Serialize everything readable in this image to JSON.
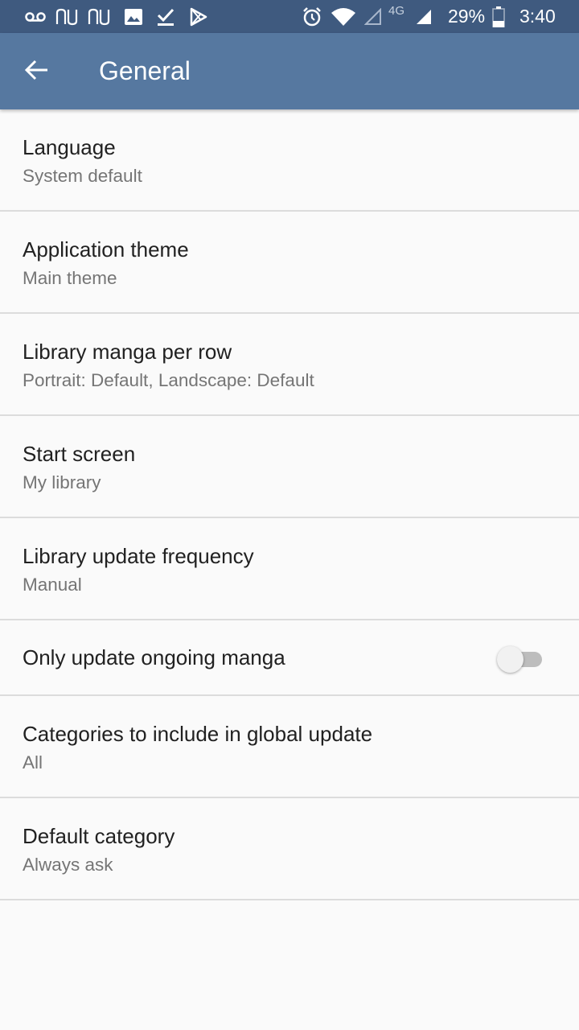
{
  "status_bar": {
    "battery_percent": "29%",
    "time": "3:40",
    "network_type": "4G",
    "icons": [
      "voicemail-icon",
      "nu-app-icon",
      "nu-app-icon",
      "image-icon",
      "check-icon",
      "play-store-icon",
      "alarm-icon",
      "wifi-icon",
      "signal-empty-icon",
      "signal-icon",
      "battery-icon"
    ]
  },
  "app_bar": {
    "title": "General",
    "back_icon": "arrow-back-icon"
  },
  "preferences": [
    {
      "title": "Language",
      "summary": "System default"
    },
    {
      "title": "Application theme",
      "summary": "Main theme"
    },
    {
      "title": "Library manga per row",
      "summary": "Portrait: Default, Landscape: Default"
    },
    {
      "title": "Start screen",
      "summary": "My library"
    },
    {
      "title": "Library update frequency",
      "summary": "Manual"
    },
    {
      "title": "Only update ongoing manga",
      "toggle_on": false
    },
    {
      "title": "Categories to include in global update",
      "summary": "All"
    },
    {
      "title": "Default category",
      "summary": "Always ask"
    }
  ],
  "colors": {
    "status_bar": "#3f5a7f",
    "app_bar": "#5678a0",
    "background": "#fafafa",
    "divider": "#dcdcdc"
  }
}
